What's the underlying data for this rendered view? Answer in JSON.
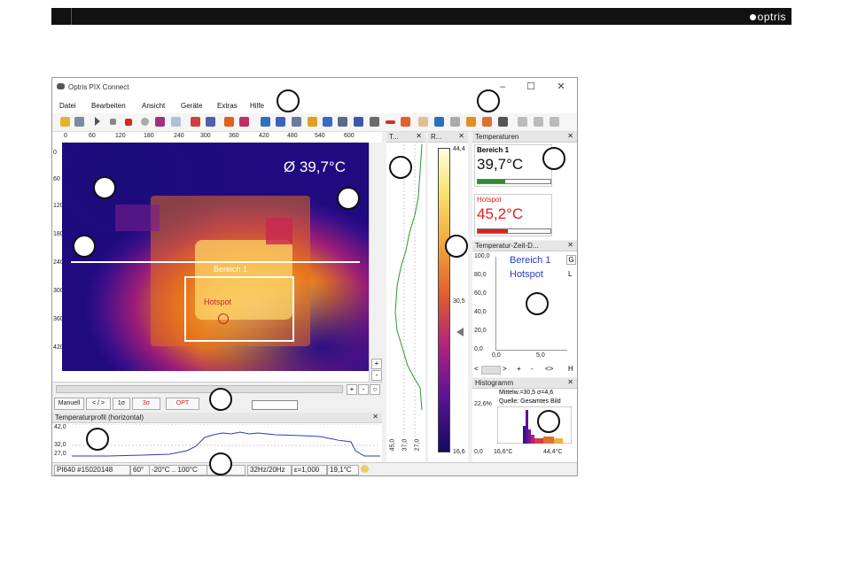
{
  "brand": {
    "logo_text": "optris"
  },
  "window": {
    "title": "Optris PIX Connect",
    "controls": {
      "minimize": "–",
      "maximize": "☐",
      "close": "✕"
    }
  },
  "menu": [
    "Datei",
    "Bearbeiten",
    "Ansicht",
    "Geräte",
    "Extras",
    "Hilfe"
  ],
  "image_view": {
    "temp_overlay": "Ø 39,7°C",
    "area_label": "Bereich 1",
    "hotspot_label": "Hotspot",
    "x_ticks": [
      "0",
      "60",
      "120",
      "180",
      "240",
      "300",
      "360",
      "420",
      "480",
      "540",
      "600"
    ],
    "y_ticks": [
      "0",
      "60",
      "120",
      "180",
      "240",
      "300",
      "360",
      "420"
    ]
  },
  "controls": {
    "manual": "Manuell",
    "arrows": "< / >",
    "one_sigma": "1σ",
    "three_sigma": "3σ",
    "opt": "OPT"
  },
  "profile": {
    "title": "Temperaturprofil (horizontal)",
    "y_ticks": [
      "42,0",
      "32,0",
      "27,0"
    ]
  },
  "t_panel": {
    "title": "T...",
    "ticks": [
      "45,0",
      "37,0",
      "27,0"
    ]
  },
  "r_panel": {
    "title": "R...",
    "max": "44,4",
    "mid": "30,5",
    "min": "16,6"
  },
  "temperatures": {
    "title": "Temperaturen",
    "items": [
      {
        "name": "Bereich 1",
        "value": "39,7°C",
        "color": "#111111",
        "bar_color": "#2e8b2e"
      },
      {
        "name": "Hotspot",
        "value": "45,2°C",
        "color": "#e01e1e",
        "bar_color": "#e01e1e"
      }
    ]
  },
  "time_chart": {
    "title": "Temperatur-Zeit-D...",
    "legend": [
      "Bereich 1",
      "Hotspot"
    ],
    "y_ticks": [
      "100,0",
      "80,0",
      "60,0",
      "40,0",
      "20,0",
      "0,0"
    ],
    "x_ticks": [
      "0,0",
      "5,0"
    ],
    "side_letters": [
      "G",
      "L",
      "H"
    ],
    "nav": [
      "<",
      ">",
      "+",
      "-",
      "<>"
    ]
  },
  "histogram": {
    "title": "Histogramm",
    "stats": "Mittelw.=30,5 σ=4,6",
    "source": "Quelle: Gesamtes Bild",
    "pct": "22,6%",
    "x_left": "0,0",
    "x_min": "16,6°C",
    "x_max": "44,4°C"
  },
  "status": {
    "device": "PI640 #15020148",
    "fov": "60°",
    "range": "-20°C .. 100°C",
    "rate": "32Hz/20Hz",
    "emissivity": "ε=1,000",
    "ambient": "19,1°C"
  }
}
